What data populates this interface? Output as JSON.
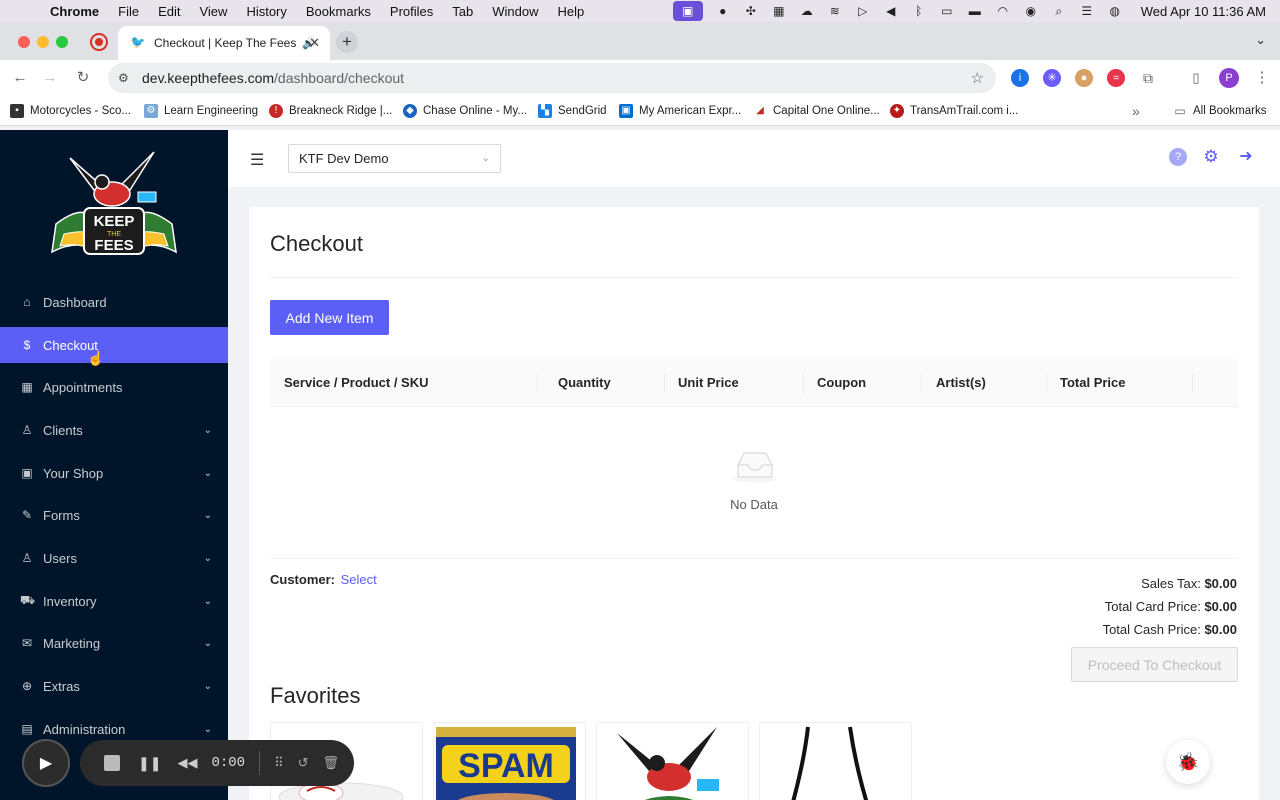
{
  "os_menubar": {
    "app_name": "Chrome",
    "menus": [
      "File",
      "Edit",
      "View",
      "History",
      "Bookmarks",
      "Profiles",
      "Tab",
      "Window",
      "Help"
    ],
    "clock": "Wed Apr 10  11:36 AM"
  },
  "browser": {
    "tab_title": "Checkout | Keep The Fees",
    "url_host": "dev.keepthefees.com",
    "url_path": "/dashboard/checkout",
    "bookmarks": [
      "Motorcycles - Sco...",
      "Learn Engineering",
      "Breakneck Ridge |...",
      "Chase Online - My...",
      "SendGrid",
      "My American Expr...",
      "Capital One Online...",
      "TransAmTrail.com i..."
    ],
    "all_bookmarks": "All Bookmarks",
    "profile_initial": "P"
  },
  "sidebar": {
    "logo_top": "KEEP",
    "logo_mid": "THE",
    "logo_bottom": "FEES",
    "items": [
      {
        "label": "Dashboard",
        "icon": "home-icon",
        "expandable": false,
        "active": false
      },
      {
        "label": "Checkout",
        "icon": "dollar-circle-icon",
        "expandable": false,
        "active": true
      },
      {
        "label": "Appointments",
        "icon": "calendar-icon",
        "expandable": false,
        "active": false
      },
      {
        "label": "Clients",
        "icon": "user-icon",
        "expandable": true,
        "active": false
      },
      {
        "label": "Your Shop",
        "icon": "shop-icon",
        "expandable": true,
        "active": false
      },
      {
        "label": "Forms",
        "icon": "form-icon",
        "expandable": true,
        "active": false
      },
      {
        "label": "Users",
        "icon": "user-icon",
        "expandable": true,
        "active": false
      },
      {
        "label": "Inventory",
        "icon": "cart-icon",
        "expandable": true,
        "active": false
      },
      {
        "label": "Marketing",
        "icon": "mail-icon",
        "expandable": true,
        "active": false
      },
      {
        "label": "Extras",
        "icon": "plus-circle-icon",
        "expandable": true,
        "active": false
      },
      {
        "label": "Administration",
        "icon": "admin-icon",
        "expandable": true,
        "active": false
      }
    ]
  },
  "header": {
    "shop_select": "KTF Dev Demo"
  },
  "main": {
    "title": "Checkout",
    "add_button": "Add New Item",
    "columns": [
      "Service / Product / SKU",
      "Quantity",
      "Unit Price",
      "Coupon",
      "Artist(s)",
      "Total Price"
    ],
    "empty_text": "No Data",
    "customer_label": "Customer:",
    "customer_link": "Select",
    "sales_tax_label": "Sales Tax:",
    "sales_tax": "$0.00",
    "card_price_label": "Total Card Price:",
    "card_price": "$0.00",
    "cash_price_label": "Total Cash Price:",
    "cash_price": "$0.00",
    "checkout_button": "Proceed To Checkout",
    "favorites_title": "Favorites",
    "spam_label": "SPAM"
  },
  "recorder": {
    "timer": "0:00"
  },
  "colors": {
    "accent": "#5b5ff5",
    "sidebar_bg": "#001529"
  }
}
